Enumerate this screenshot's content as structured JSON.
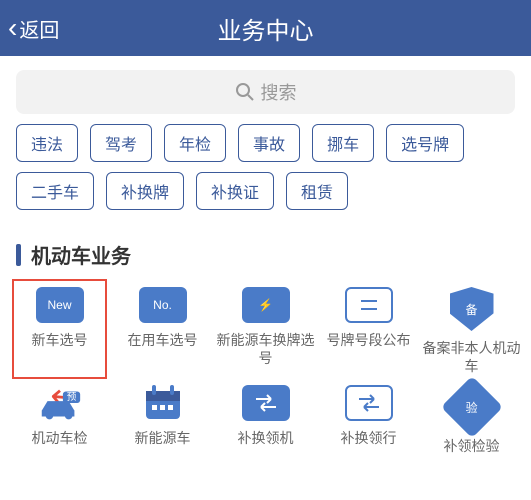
{
  "header": {
    "back_label": "返回",
    "title": "业务中心"
  },
  "search": {
    "placeholder": "搜索"
  },
  "tags": [
    "违法",
    "驾考",
    "年检",
    "事故",
    "挪车",
    "选号牌",
    "二手车",
    "补换牌",
    "补换证",
    "租赁"
  ],
  "section1": {
    "title": "机动车业务",
    "items": [
      {
        "icon_text": "New",
        "label": "新车选号",
        "highlight": true
      },
      {
        "icon_text": "No.",
        "label": "在用车选号"
      },
      {
        "icon_text": "⚡",
        "label": "新能源车换牌选号"
      },
      {
        "icon_text": "",
        "label": "号牌号段公布"
      },
      {
        "icon_text": "备",
        "label": "备案非本人机动车"
      },
      {
        "icon_text": "预",
        "label": "机动车检"
      },
      {
        "icon_text": "",
        "label": "新能源车"
      },
      {
        "icon_text": "",
        "label": "补换领机"
      },
      {
        "icon_text": "",
        "label": "补换领行"
      },
      {
        "icon_text": "验",
        "label": "补领检验"
      }
    ]
  }
}
